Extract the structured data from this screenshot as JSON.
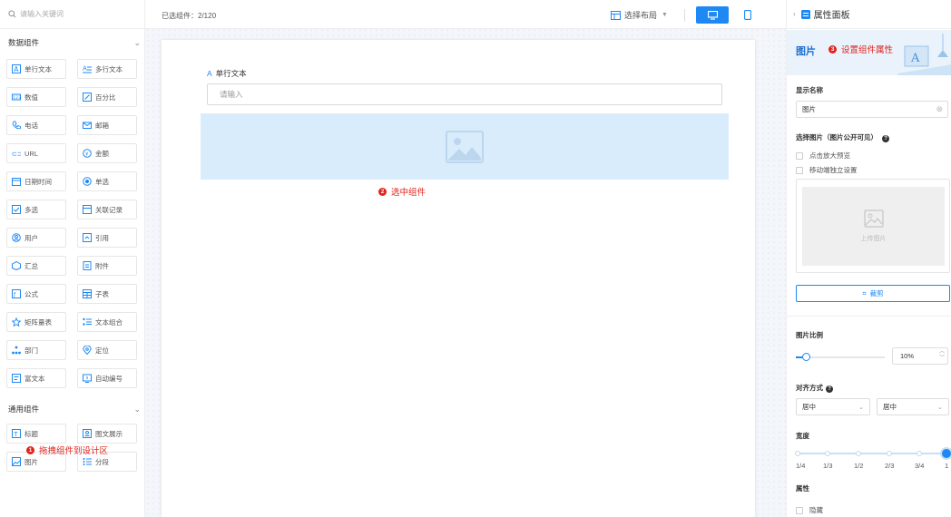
{
  "left_panel": {
    "search_placeholder": "请输入关键词",
    "data_group": {
      "title": "数据组件",
      "items": [
        "单行文本",
        "多行文本",
        "数值",
        "百分比",
        "电话",
        "邮箱",
        "URL",
        "金额",
        "日期时间",
        "单选",
        "多选",
        "关联记录",
        "用户",
        "引用",
        "汇总",
        "附件",
        "公式",
        "子表",
        "矩阵量表",
        "文本组合",
        "部门",
        "定位",
        "富文本",
        "自动编号"
      ]
    },
    "general_group": {
      "title": "通用组件",
      "items": [
        "标题",
        "图文展示",
        "图片",
        "分段"
      ]
    }
  },
  "toolbar": {
    "selected_count": "已选组件：2/120",
    "layout_label": "选择布局"
  },
  "canvas": {
    "field_label": "单行文本",
    "field_placeholder": "请输入"
  },
  "annotations": {
    "step1": "拖拽组件到设计区",
    "step2": "选中组件",
    "step3": "设置组件属性",
    "num1": "1",
    "num2": "2",
    "num3": "3"
  },
  "right_panel": {
    "title": "属性面板",
    "banner_title": "图片",
    "display_name_label": "显示名称",
    "display_name_value": "图片",
    "select_image_label": "选择图片（图片公开可见）",
    "option_zoom": "点击放大预览",
    "option_mobile": "移动端独立设置",
    "upload_label": "上传图片",
    "crop_label": "裁剪",
    "ratio_label": "图片比例",
    "ratio_value": "10%",
    "align_label": "对齐方式",
    "align_h": "居中",
    "align_v": "居中",
    "width_label": "宽度",
    "width_ticks": [
      "1/4",
      "1/3",
      "1/2",
      "2/3",
      "3/4",
      "1"
    ],
    "attr_label": "属性",
    "hidden_label": "隐藏"
  },
  "colors": {
    "accent": "#1e88f3",
    "annotation_red": "#e0231d",
    "selected_block": "#d9ecfc"
  }
}
